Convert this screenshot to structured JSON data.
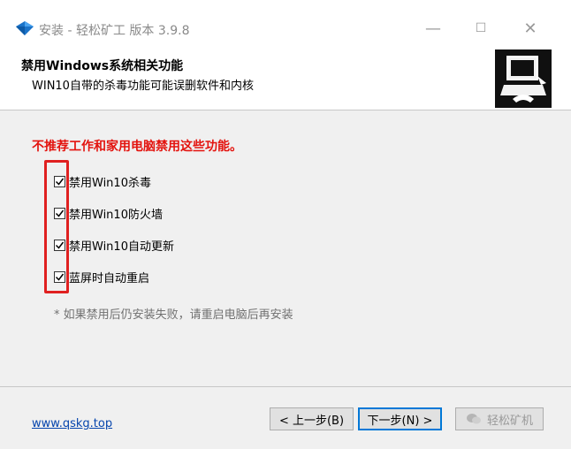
{
  "window": {
    "title": "安装 - 轻松矿工 版本 3.9.8",
    "minimize": "—",
    "maximize": "☐",
    "close": "✕"
  },
  "header": {
    "title": "禁用Windows系统相关功能",
    "subtitle": "WIN10自带的杀毒功能可能误删软件和内核"
  },
  "content": {
    "warning": "不推荐工作和家用电脑禁用这些功能。",
    "options": [
      {
        "label": "禁用Win10杀毒",
        "checked": true
      },
      {
        "label": "禁用Win10防火墙",
        "checked": true
      },
      {
        "label": "禁用Win10自动更新",
        "checked": true
      },
      {
        "label": "蓝屏时自动重启",
        "checked": true
      }
    ],
    "note": "* 如果禁用后仍安装失败，请重启电脑后再安装"
  },
  "footer": {
    "link": "www.qskg.top",
    "back_label": "< 上一步(B)",
    "next_label": "下一步(N) >",
    "third_label": "轻松矿机"
  },
  "colors": {
    "warning": "#e3130e",
    "highlight": "#e02020",
    "link": "#0645ad",
    "default_button_border": "#0078d7"
  }
}
